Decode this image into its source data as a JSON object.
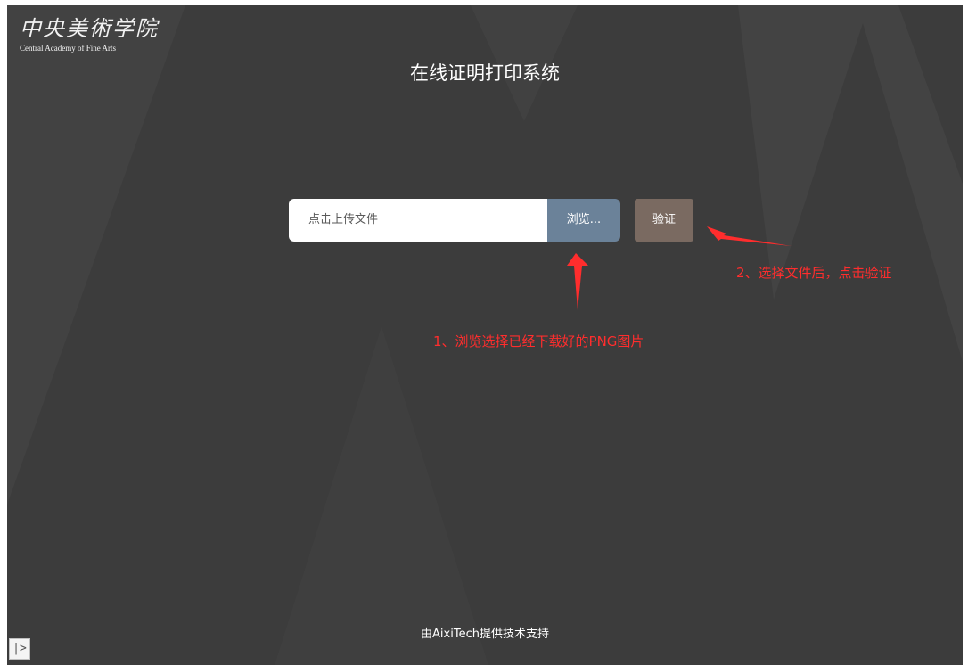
{
  "logo": {
    "name_cn": "中央美術学院",
    "name_en": "Central Academy of Fine Arts"
  },
  "page": {
    "title": "在线证明打印系统"
  },
  "upload": {
    "placeholder": "点击上传文件",
    "browse_label": "浏览...",
    "verify_label": "验证"
  },
  "annotations": {
    "step1": "1、浏览选择已经下载好的PNG图片",
    "step2": "2、选择文件后，点击验证",
    "color": "#ff2d2d"
  },
  "footer": {
    "text": "由AixiTech提供技术支持"
  },
  "sidebar_toggle": {
    "icon": "sidebar-toggle-icon",
    "glyph": "|>"
  },
  "theme": {
    "background": "#3c3c3c",
    "browse_button": "#6b8299",
    "verify_button": "#7a6a61"
  }
}
